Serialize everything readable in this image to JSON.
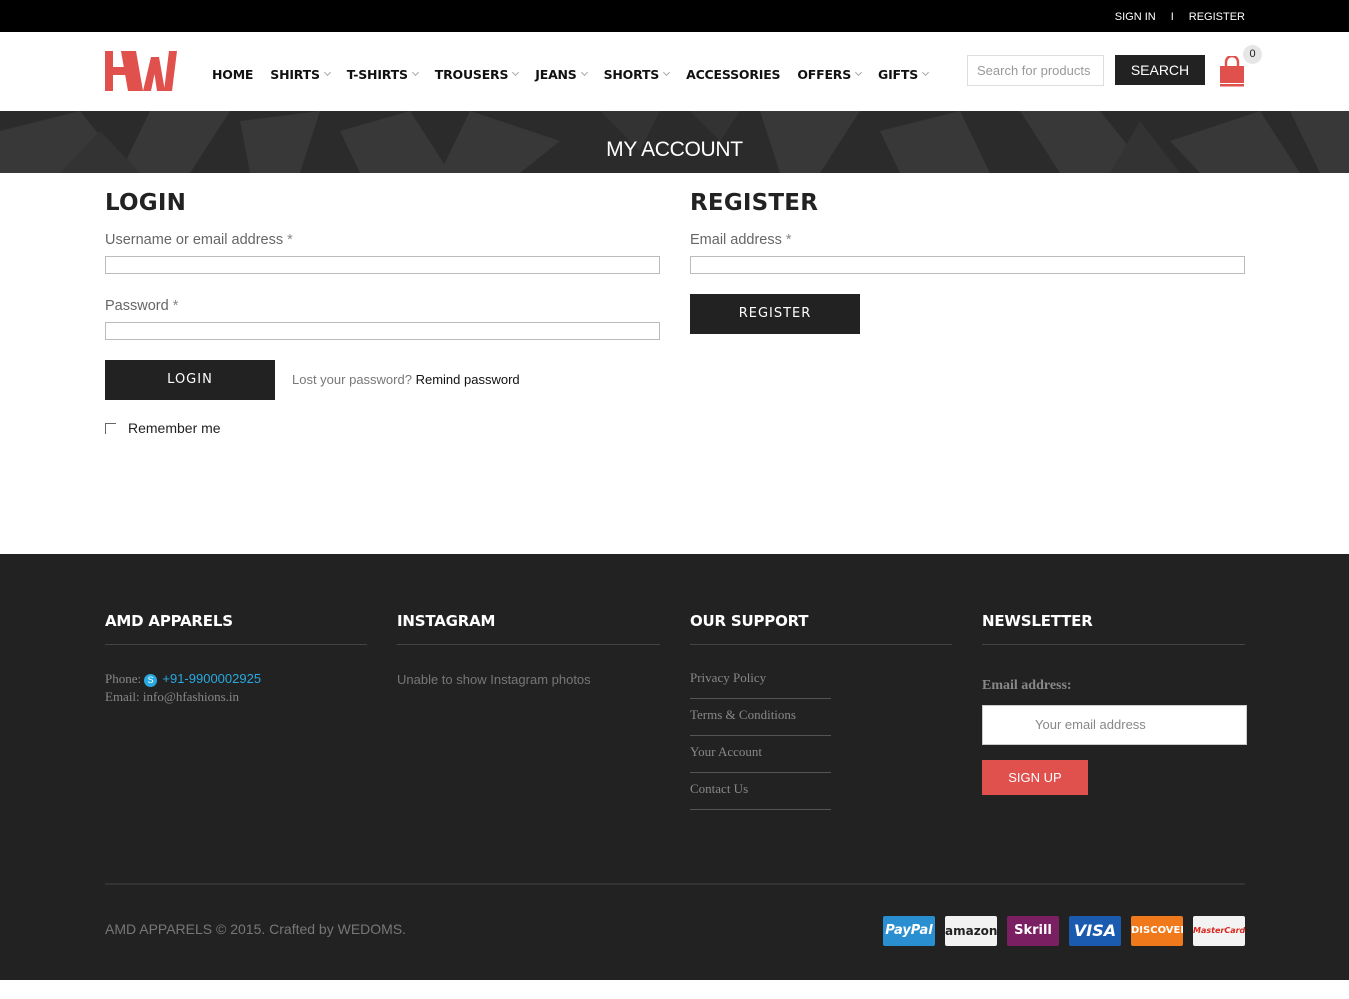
{
  "topbar": {
    "sign_in": "SIGN IN",
    "separator": "I",
    "register": "REGISTER"
  },
  "brand": {
    "logo_text": "HW",
    "accent_color": "#e0504d"
  },
  "nav": [
    {
      "label": "HOME",
      "has_dropdown": false
    },
    {
      "label": "SHIRTS",
      "has_dropdown": true
    },
    {
      "label": "T-SHIRTS",
      "has_dropdown": true
    },
    {
      "label": "TROUSERS",
      "has_dropdown": true
    },
    {
      "label": "JEANS",
      "has_dropdown": true
    },
    {
      "label": "SHORTS",
      "has_dropdown": true
    },
    {
      "label": "ACCESSORIES",
      "has_dropdown": false
    },
    {
      "label": "OFFERS",
      "has_dropdown": true
    },
    {
      "label": "GIFTS",
      "has_dropdown": true
    }
  ],
  "search": {
    "placeholder": "Search for products",
    "button": "SEARCH"
  },
  "cart": {
    "count": "0",
    "icon": "shopping-bag-icon"
  },
  "banner": {
    "title": "MY ACCOUNT"
  },
  "login": {
    "title": "LOGIN",
    "username_label": "Username or email address",
    "password_label": "Password",
    "required_mark": "*",
    "button": "LOGIN",
    "lost_text": "Lost your password?",
    "remind_link": "Remind password",
    "remember": "Remember me"
  },
  "register": {
    "title": "REGISTER",
    "email_label": "Email address",
    "required_mark": "*",
    "button": "REGISTER"
  },
  "footer": {
    "about": {
      "title": "AMD APPARELS",
      "phone_label": "Phone:",
      "phone": "+91-9900002925",
      "email_label": "Email:",
      "email": "info@hfashions.in"
    },
    "instagram": {
      "title": "INSTAGRAM",
      "text": "Unable to show Instagram photos"
    },
    "support": {
      "title": "OUR SUPPORT",
      "links": [
        "Privacy Policy",
        "Terms & Conditions",
        "Your Account",
        "Contact Us"
      ]
    },
    "newsletter": {
      "title": "NEWSLETTER",
      "label": "Email address:",
      "placeholder": "Your email address",
      "button": "SIGN UP"
    },
    "copyright": "AMD APPARELS © 2015. Crafted by WEDOMS.",
    "payments": [
      {
        "name": "PayPal",
        "bg": "#2a8fd0",
        "fg": "#ffffff"
      },
      {
        "name": "amazon",
        "bg": "#f2f2f2",
        "fg": "#222222"
      },
      {
        "name": "Skrill",
        "bg": "#7b1f63",
        "fg": "#ffffff"
      },
      {
        "name": "VISA",
        "bg": "#1a5bb0",
        "fg": "#ffffff"
      },
      {
        "name": "DISCOVER",
        "bg": "#f07a1b",
        "fg": "#ffffff"
      },
      {
        "name": "MasterCard",
        "bg": "#f3f3f3",
        "fg": "#d9261c"
      }
    ]
  }
}
